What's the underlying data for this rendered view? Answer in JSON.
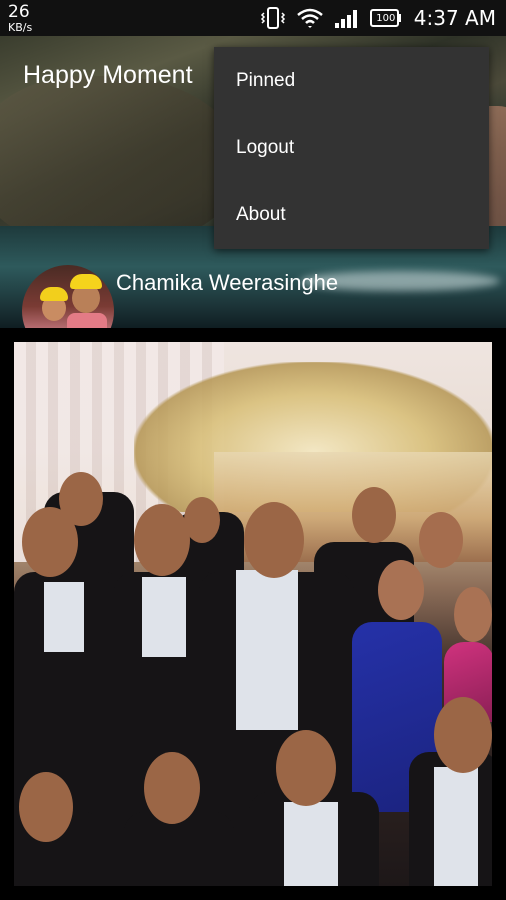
{
  "status_bar": {
    "net_speed": "26",
    "net_unit": "KB/s",
    "battery": "100",
    "time": "4:37 AM"
  },
  "header": {
    "app_title": "Happy Moment",
    "user_name": "Chamika Weerasinghe"
  },
  "menu": {
    "items": [
      {
        "label": "Pinned"
      },
      {
        "label": "Logout"
      },
      {
        "label": "About"
      }
    ]
  },
  "icons": {
    "vibrate": "vibrate-icon",
    "wifi": "wifi-icon",
    "signal": "signal-icon",
    "battery": "battery-icon"
  },
  "colors": {
    "status_bar_bg": "#111111",
    "menu_bg": "#333333",
    "background": "#000000"
  }
}
